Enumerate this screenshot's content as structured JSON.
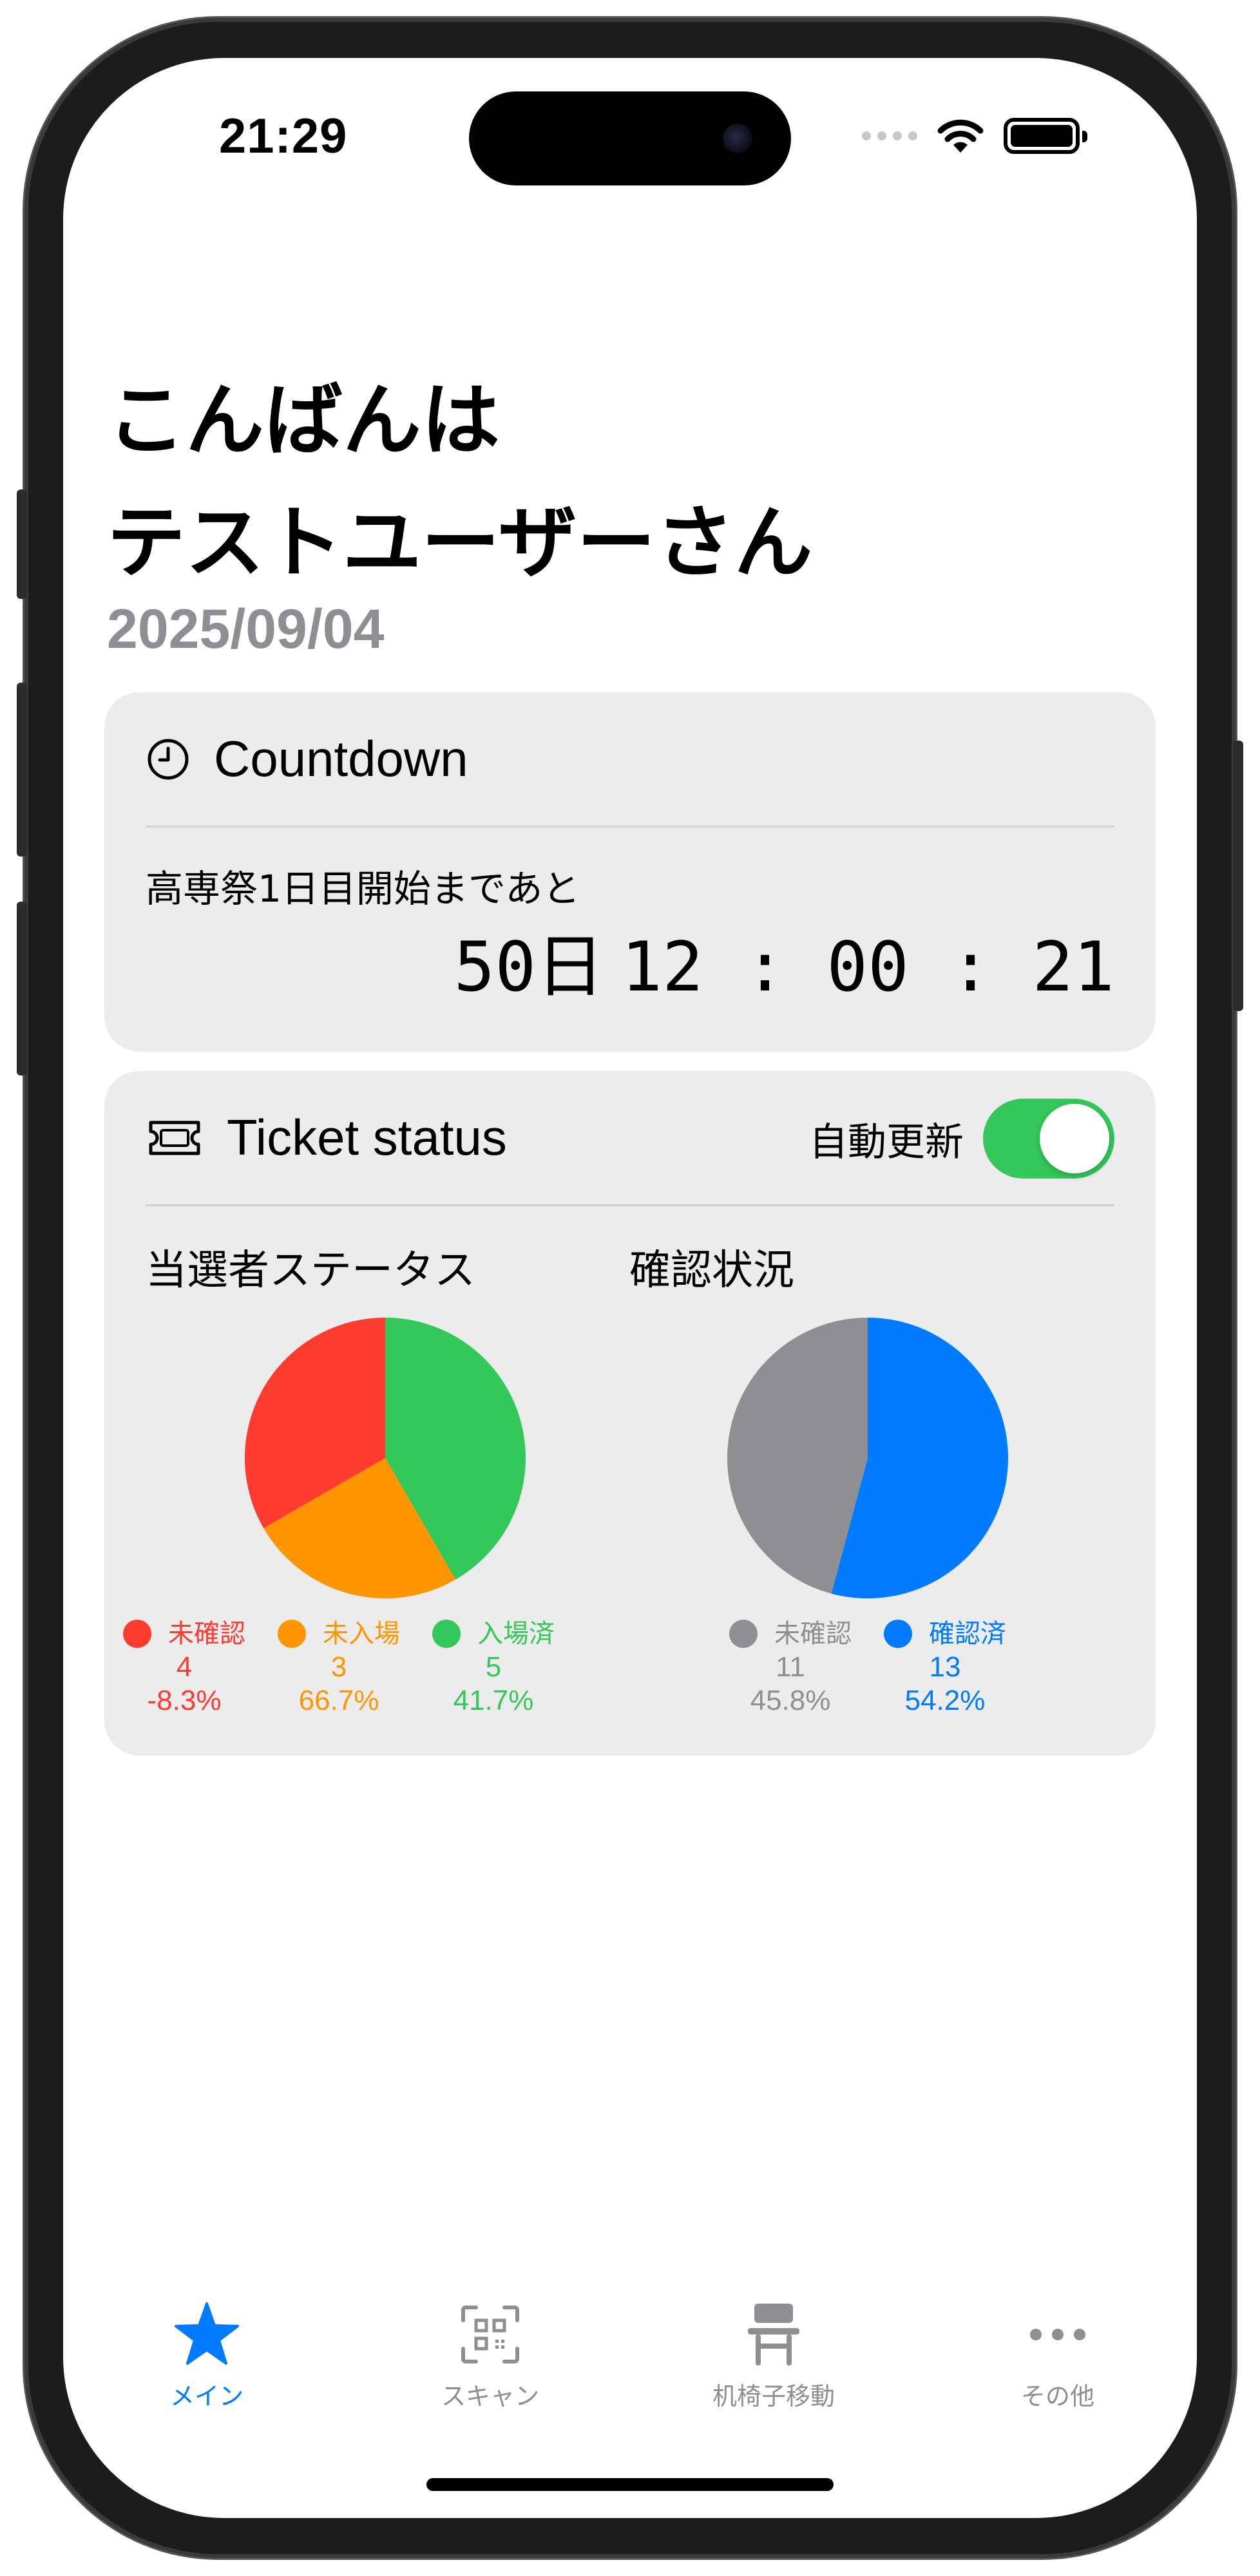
{
  "status_bar": {
    "time": "21:29"
  },
  "greeting": {
    "line1": "こんばんは",
    "line2": "テストユーザーさん",
    "date": "2025/09/04"
  },
  "countdown": {
    "title": "Countdown",
    "label": "高専祭1日目開始まであと",
    "days": "50日",
    "clock": "12 : 00 : 21"
  },
  "ticket": {
    "title": "Ticket status",
    "auto_update_label": "自動更新",
    "auto_update_on": true,
    "winner_status": {
      "title": "当選者ステータス",
      "items": [
        {
          "name": "未確認",
          "count": "4",
          "percent": "-8.3%",
          "color": "#ff3b30"
        },
        {
          "name": "未入場",
          "count": "3",
          "percent": "66.7%",
          "color": "#ff9500"
        },
        {
          "name": "入場済",
          "count": "5",
          "percent": "41.7%",
          "color": "#34c759"
        }
      ]
    },
    "confirm_status": {
      "title": "確認状況",
      "items": [
        {
          "name": "未確認",
          "count": "11",
          "percent": "45.8%",
          "color": "#8e8e93"
        },
        {
          "name": "確認済",
          "count": "13",
          "percent": "54.2%",
          "color": "#007aff"
        }
      ]
    }
  },
  "chart_data": [
    {
      "type": "pie",
      "title": "当選者ステータス",
      "categories": [
        "未確認",
        "未入場",
        "入場済"
      ],
      "values": [
        4,
        3,
        5
      ],
      "colors": [
        "#ff3b30",
        "#ff9500",
        "#34c759"
      ]
    },
    {
      "type": "pie",
      "title": "確認状況",
      "categories": [
        "未確認",
        "確認済"
      ],
      "values": [
        11,
        13
      ],
      "colors": [
        "#8e8e93",
        "#007aff"
      ]
    }
  ],
  "tabbar": {
    "tabs": [
      {
        "label": "メイン",
        "icon": "star-icon",
        "active": true
      },
      {
        "label": "スキャン",
        "icon": "qr-scan-icon",
        "active": false
      },
      {
        "label": "机椅子移動",
        "icon": "desk-chair-icon",
        "active": false
      },
      {
        "label": "その他",
        "icon": "ellipsis-icon",
        "active": false
      }
    ],
    "active_color": "#007aff",
    "inactive_color": "#8e8e93"
  }
}
